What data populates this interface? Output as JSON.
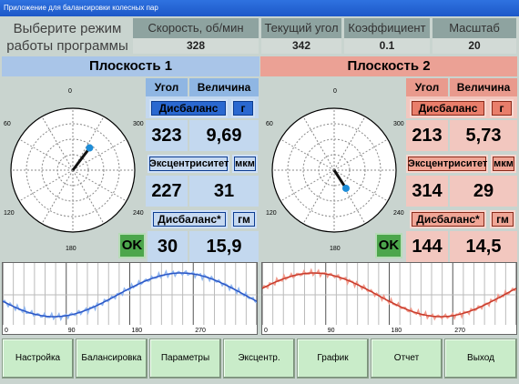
{
  "window": {
    "title": "Приложение для балансировки колесных пар"
  },
  "mode_prompt": "Выберите режим работы программы",
  "status": {
    "speed_label": "Скорость, об/мин",
    "speed_value": "328",
    "angle_label": "Текущий угол",
    "angle_value": "342",
    "coef_label": "Коэффициент",
    "coef_value": "0.1",
    "scale_label": "Масштаб",
    "scale_value": "20"
  },
  "plane1": {
    "title": "Плоскость 1",
    "angle_header": "Угол",
    "value_header": "Величина",
    "imbalance_label": "Дисбаланс",
    "imbalance_unit": "г",
    "imbalance_angle": "323",
    "imbalance_value": "9,69",
    "ecc_label": "Эксцентриситет",
    "ecc_unit": "мкм",
    "ecc_angle": "227",
    "ecc_value": "31",
    "imbalance2_label": "Дисбаланс*",
    "imbalance2_unit": "гм",
    "ok": "OK",
    "imbalance2_angle": "30",
    "imbalance2_value": "15,9",
    "vector_angle_deg": 323,
    "vector_magnitude": 0.45
  },
  "plane2": {
    "title": "Плоскость 2",
    "angle_header": "Угол",
    "value_header": "Величина",
    "imbalance_label": "Дисбаланс",
    "imbalance_unit": "г",
    "imbalance_angle": "213",
    "imbalance_value": "5,73",
    "ecc_label": "Эксцентриситет",
    "ecc_unit": "мкм",
    "ecc_angle": "314",
    "ecc_value": "29",
    "imbalance2_label": "Дисбаланс*",
    "imbalance2_unit": "гм",
    "ok": "OK",
    "imbalance2_angle": "144",
    "imbalance2_value": "14,5",
    "vector_angle_deg": 213,
    "vector_magnitude": 0.35
  },
  "polar_labels": {
    "top": "0",
    "right_top": "300",
    "left_top": "60",
    "left_bottom": "120",
    "right_bottom": "240",
    "bottom": "180"
  },
  "graph_ticks": [
    "0",
    "90",
    "180",
    "270"
  ],
  "buttons": [
    "Настройка",
    "Балансировка",
    "Параметры",
    "Эксцентр.",
    "График",
    "Отчет",
    "Выход"
  ],
  "colors": {
    "plane1": "#a9c5e8",
    "plane2": "#eba195",
    "ok": "#4ca64c",
    "vector": "#1e8dd8"
  }
}
